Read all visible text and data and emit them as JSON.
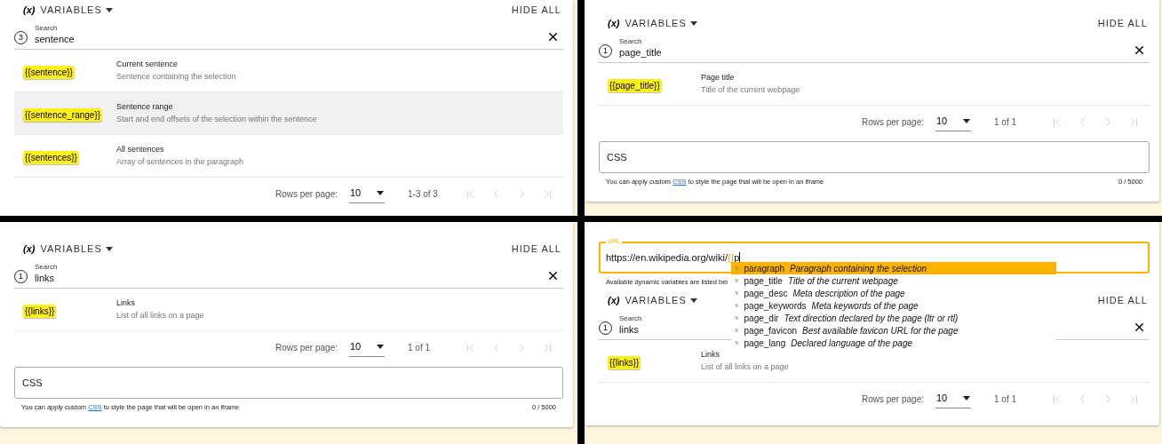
{
  "panels": [
    {
      "variables": {
        "icon_text": "(x)",
        "label": "VARIABLES",
        "hide_all": "HIDE ALL"
      },
      "search": {
        "label": "Search",
        "count": "3",
        "value": "sentence"
      },
      "rows": [
        {
          "token": "{{sentence}}",
          "title": "Current sentence",
          "description": "Sentence containing the selection",
          "selected": false
        },
        {
          "token": "{{sentence_range}}",
          "title": "Sentence range",
          "description": "Start and end offsets of the selection within the sentence",
          "selected": true
        },
        {
          "token": "{{sentences}}",
          "title": "All sentences",
          "description": "Array of sentences in the paragraph",
          "selected": false
        }
      ],
      "pagination": {
        "rows_per_page_label": "Rows per page:",
        "rows_per_page": "10",
        "range": "1-3 of 3"
      }
    },
    {
      "variables": {
        "icon_text": "(x)",
        "label": "VARIABLES",
        "hide_all": "HIDE ALL"
      },
      "search": {
        "label": "Search",
        "count": "1",
        "value": "page_title"
      },
      "rows": [
        {
          "token": "{{page_title}}",
          "title": "Page title",
          "description": "Title of the current webpage",
          "selected": false
        }
      ],
      "pagination": {
        "rows_per_page_label": "Rows per page:",
        "rows_per_page": "10",
        "range": "1 of 1"
      },
      "css": {
        "label": "CSS",
        "helper_before": "You can apply custom ",
        "link": "CSS",
        "helper_after": " to style the page that will be open in an iframe",
        "counter": "0 / 5000"
      }
    },
    {
      "variables": {
        "icon_text": "(x)",
        "label": "VARIABLES",
        "hide_all": "HIDE ALL"
      },
      "search": {
        "label": "Search",
        "count": "1",
        "value": "links"
      },
      "rows": [
        {
          "token": "{{links}}",
          "title": "Links",
          "description": "List of all links on a page",
          "selected": false
        }
      ],
      "pagination": {
        "rows_per_page_label": "Rows per page:",
        "rows_per_page": "10",
        "range": "1 of 1"
      },
      "css": {
        "label": "CSS",
        "helper_before": "You can apply custom ",
        "link": "CSS",
        "helper_after": " to style the page that will be open in an iframe",
        "counter": "0 / 5000"
      }
    },
    {
      "url": {
        "label": "URL",
        "value_parts": [
          {
            "kind": "plain",
            "text": "https://en.wikipedia.org/wiki/"
          },
          {
            "kind": "brace",
            "text": "{{"
          },
          {
            "kind": "plain",
            "text": "p"
          }
        ],
        "helper": "Available dynamic variables are listed bel"
      },
      "suggestions": [
        {
          "glyph": "x",
          "name": "paragraph",
          "description": "Paragraph containing the selection",
          "selected": true
        },
        {
          "glyph": "x",
          "name": "page_title",
          "description": "Title of the current webpage",
          "selected": false
        },
        {
          "glyph": "x",
          "name": "page_desc",
          "description": "Meta description of the page",
          "selected": false
        },
        {
          "glyph": "x",
          "name": "page_keywords",
          "description": "Meta keywords of the page",
          "selected": false
        },
        {
          "glyph": "x",
          "name": "page_dir",
          "description": "Text direction declared by the page (ltr or rtl)",
          "selected": false
        },
        {
          "glyph": "x",
          "name": "page_favicon",
          "description": "Best available favicon URL for the page",
          "selected": false
        },
        {
          "glyph": "x",
          "name": "page_lang",
          "description": "Declared language of the page",
          "selected": false
        }
      ],
      "variables": {
        "icon_text": "(x)",
        "label": "VARIABLES",
        "hide_all": "HIDE ALL"
      },
      "search": {
        "label": "Search",
        "count": "1",
        "value": "links"
      },
      "rows": [
        {
          "token": "{{links}}",
          "title": "Links",
          "description": "List of all links on a page",
          "selected": false
        }
      ],
      "pagination": {
        "rows_per_page_label": "Rows per page:",
        "rows_per_page": "10",
        "range": "1 of 1"
      }
    }
  ]
}
